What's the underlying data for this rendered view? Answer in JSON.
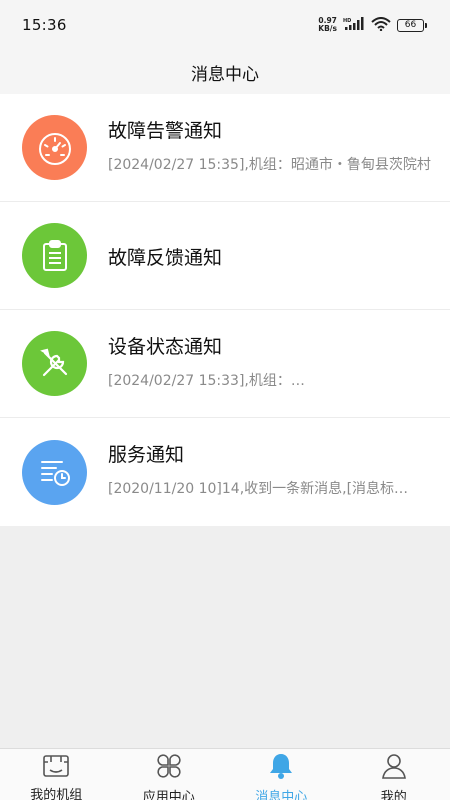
{
  "status_bar": {
    "time": "15:36",
    "net_speed_value": "0.97",
    "net_speed_unit": "KB/s",
    "battery": "66"
  },
  "header": {
    "title": "消息中心"
  },
  "messages": [
    {
      "title": "故障告警通知",
      "desc": "[2024/02/27 15:35],机组：昭通市・鲁甸县茨院村",
      "icon": "gauge-icon",
      "color": "#fa7d56"
    },
    {
      "title": "故障反馈通知",
      "desc": "",
      "icon": "clipboard-icon",
      "color": "#6cc739"
    },
    {
      "title": "设备状态通知",
      "desc": "[2024/02/27 15:33],机组：…",
      "icon": "tools-icon",
      "color": "#6cc739"
    },
    {
      "title": "服务通知",
      "desc": "[2020/11/20 10]14,收到一条新消息,[消息标…",
      "icon": "list-clock-icon",
      "color": "#5aa4f0"
    }
  ],
  "tabbar": {
    "items": [
      {
        "label": "我的机组",
        "icon": "unit-icon",
        "active": false
      },
      {
        "label": "应用中心",
        "icon": "apps-icon",
        "active": false
      },
      {
        "label": "消息中心",
        "icon": "bell-icon",
        "active": true
      },
      {
        "label": "我的",
        "icon": "user-icon",
        "active": false
      }
    ],
    "active_color": "#3fa6e6"
  }
}
